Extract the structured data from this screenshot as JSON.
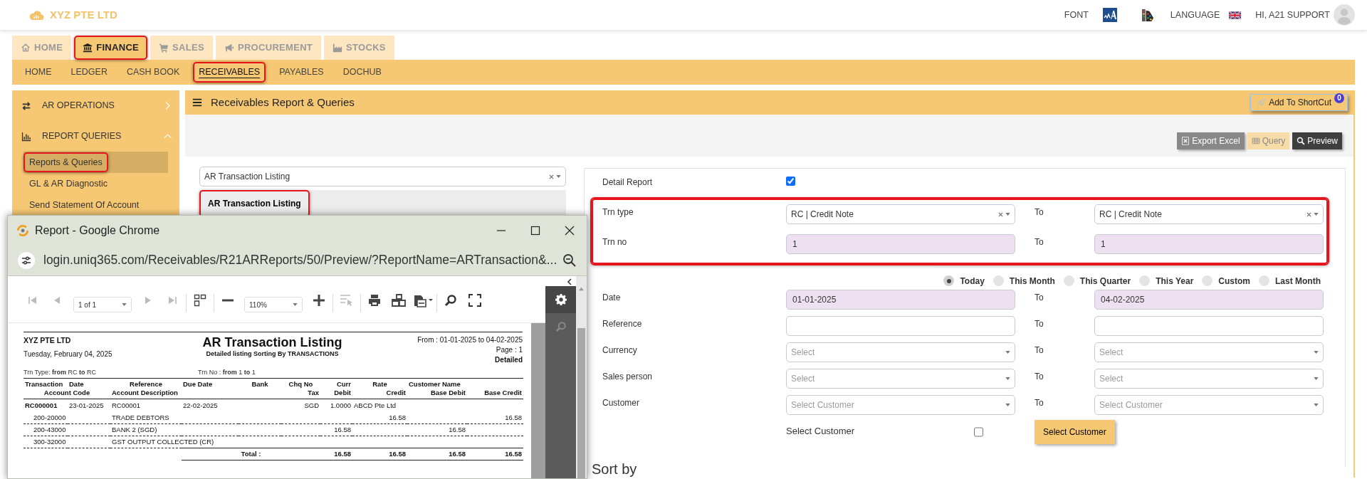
{
  "header": {
    "company": "XYZ PTE LTD",
    "font_label": "FONT",
    "language_label": "LANGUAGE",
    "greeting": "HI, A21 SUPPORT"
  },
  "modules": [
    {
      "label": "HOME",
      "selected": false,
      "highlighted": false
    },
    {
      "label": "FINANCE",
      "selected": true,
      "highlighted": true
    },
    {
      "label": "SALES",
      "selected": false,
      "highlighted": false
    },
    {
      "label": "PROCUREMENT",
      "selected": false,
      "highlighted": false
    },
    {
      "label": "STOCKS",
      "selected": false,
      "highlighted": false
    }
  ],
  "subnav": [
    {
      "label": "HOME",
      "selected": false,
      "highlighted": false
    },
    {
      "label": "LEDGER",
      "selected": false,
      "highlighted": false
    },
    {
      "label": "CASH BOOK",
      "selected": false,
      "highlighted": false
    },
    {
      "label": "RECEIVABLES",
      "selected": true,
      "highlighted": true
    },
    {
      "label": "PAYABLES",
      "selected": false,
      "highlighted": false
    },
    {
      "label": "DOCHUB",
      "selected": false,
      "highlighted": false
    }
  ],
  "sidebar": {
    "sections": [
      {
        "label": "AR OPERATIONS",
        "expanded": false
      },
      {
        "label": "REPORT QUERIES",
        "expanded": true,
        "items": [
          {
            "label": "Reports & Queries",
            "selected": true,
            "highlighted": true
          },
          {
            "label": "GL & AR Diagnostic",
            "selected": false,
            "highlighted": false
          },
          {
            "label": "Send Statement Of Account",
            "selected": false,
            "highlighted": false
          }
        ]
      }
    ]
  },
  "panel": {
    "title": "Receivables Report & Queries",
    "shortcut": {
      "label": "Add To ShortCut",
      "badge": "0"
    },
    "toolbar": [
      {
        "label": "Export Excel",
        "kind": "export"
      },
      {
        "label": "Query",
        "kind": "query"
      },
      {
        "label": "Preview",
        "kind": "preview"
      }
    ]
  },
  "report_picker": {
    "value": "AR Transaction Listing",
    "items": [
      {
        "label": "AR Transaction Listing",
        "selected": true,
        "highlighted": true
      }
    ]
  },
  "form": {
    "detail_report": {
      "label": "Detail Report",
      "checked": true
    },
    "groups": [
      {
        "highlighted": true,
        "rows": [
          {
            "label": "Trn type",
            "kind": "select",
            "to_label": "To",
            "from": {
              "value": "RC | Credit Note",
              "required": false
            },
            "to": {
              "value": "RC | Credit Note",
              "required": false
            }
          },
          {
            "label": "Trn no",
            "kind": "input",
            "to_label": "To",
            "from": {
              "value": "1",
              "required": true
            },
            "to": {
              "value": "1",
              "required": true
            }
          }
        ]
      },
      {
        "periods": [
          {
            "label": "Today",
            "selected": true
          },
          {
            "label": "This Month",
            "selected": false
          },
          {
            "label": "This Quarter",
            "selected": false
          },
          {
            "label": "This Year",
            "selected": false
          },
          {
            "label": "Custom",
            "selected": false
          },
          {
            "label": "Last Month",
            "selected": false
          }
        ],
        "rows": [
          {
            "label": "Date",
            "kind": "input",
            "to_label": "To",
            "from": {
              "value": "01-01-2025",
              "required": true
            },
            "to": {
              "value": "04-02-2025",
              "required": true
            }
          },
          {
            "label": "Reference",
            "kind": "input",
            "to_label": "To",
            "from": {
              "required": false
            },
            "to": {
              "required": false
            }
          },
          {
            "label": "Currency",
            "kind": "select",
            "to_label": "To",
            "from": {
              "placeholder": "Select",
              "required": false
            },
            "to": {
              "placeholder": "Select",
              "required": false
            }
          },
          {
            "label": "Sales person",
            "kind": "select",
            "to_label": "To",
            "from": {
              "placeholder": "Select",
              "required": false
            },
            "to": {
              "placeholder": "Select",
              "required": false
            }
          },
          {
            "label": "Customer",
            "kind": "select",
            "to_label": "To",
            "from": {
              "placeholder": "Select Customer",
              "required": false
            },
            "to": {
              "placeholder": "Select Customer",
              "required": false
            }
          }
        ]
      }
    ],
    "select_customer": {
      "label": "Select Customer",
      "checked": false,
      "button": "Select Customer"
    },
    "sort_by": "Sort by"
  },
  "report_window": {
    "title": "Report - Google Chrome",
    "url": "login.uniq365.com/Receivables/R21ARReports/50/Preview/?ReportName=ARTransaction&...",
    "page_selector": "1 of 1",
    "zoom": "110%",
    "report": {
      "company": "XYZ PTE LTD",
      "date": "Tuesday, February 04, 2025",
      "title": "AR Transaction Listing",
      "subtitle": "Detailed listing Sorting By TRANSACTIONS",
      "range": "From : 01-01-2025 to 04-02-2025",
      "page": "Page : 1",
      "mode": "Detailed",
      "trn_type": "Trn Type: **from** RC **to** RC",
      "trn_no": "Trn No : **from** 1 **to** 1",
      "columns_1": [
        "Transaction",
        "Date",
        "Reference",
        "Due Date",
        "Bank",
        "Chq No",
        "Curr",
        "Rate",
        "Customer Name"
      ],
      "columns_2": [
        "Account Code",
        "Account Description",
        "Tax",
        "Debit",
        "Credit",
        "Base Debit",
        "Base Credit"
      ],
      "transactions": [
        {
          "number": "RC000001",
          "date": "23-01-2025",
          "reference": "RC00001",
          "due_date": "22-02-2025",
          "currency": "SGD",
          "rate": "1.0000",
          "customer": "ABCD Pte Ltd",
          "lines": [
            {
              "account_code": "200-20000",
              "description": "TRADE DEBTORS",
              "credit": "16.58",
              "base_credit": "16.58"
            },
            {
              "account_code": "200-43000",
              "description": "BANK 2 (SGD)",
              "debit": "16.58",
              "base_debit": "16.58"
            },
            {
              "account_code": "300-32000",
              "description": "GST OUTPUT COLLECTED (CR)"
            }
          ]
        }
      ],
      "total": {
        "label": "Total :",
        "debit": "16.58",
        "credit": "16.58",
        "base_debit": "16.58",
        "base_credit": "16.58"
      }
    }
  }
}
